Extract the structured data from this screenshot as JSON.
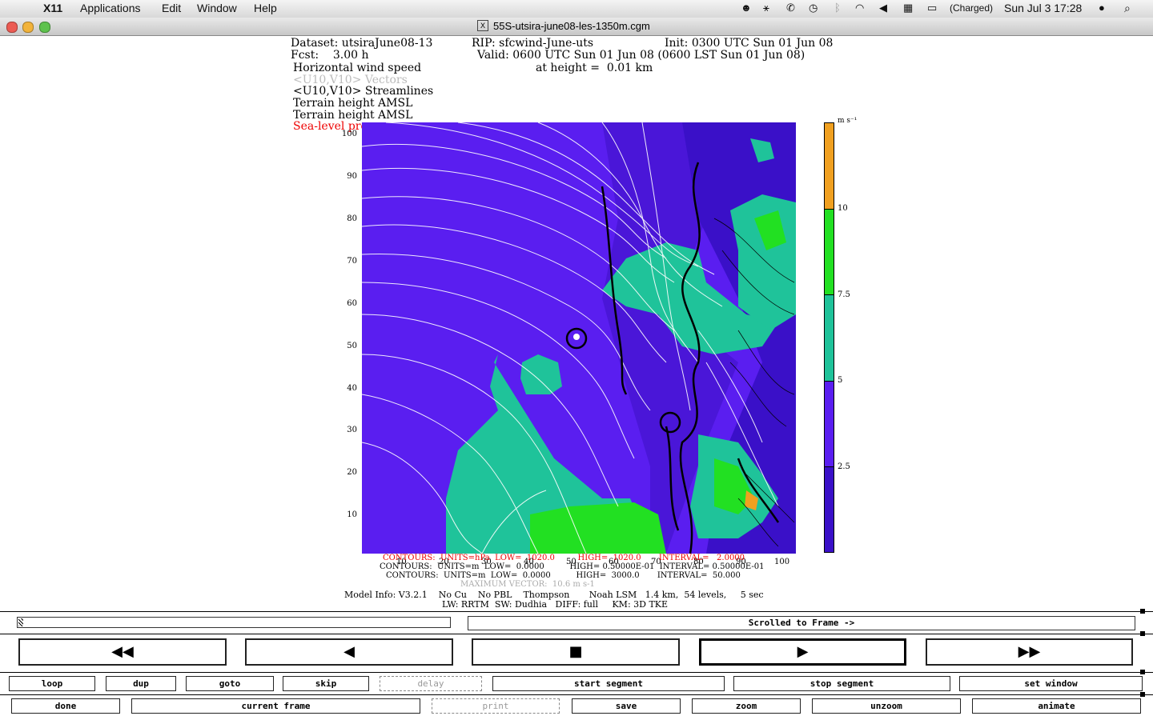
{
  "menubar": {
    "app": "X11",
    "items": [
      "Applications",
      "Edit",
      "Window",
      "Help"
    ],
    "battery": "(Charged)",
    "clock": "Sun Jul 3  17:28"
  },
  "window": {
    "title": "55S-utsira-june08-les-1350m.cgm"
  },
  "plot": {
    "line1a": "Dataset: utsiraJune08-13",
    "line1b": "RIP: sfcwind-June-uts",
    "line1c": "Init: 0300 UTC Sun 01 Jun 08",
    "line2a": "Fcst:    3.00 h",
    "line2b": "Valid: 0600 UTC Sun 01 Jun 08 (0600 LST Sun 01 Jun 08)",
    "line3a": "Horizontal wind speed",
    "line3b": "at height =  0.01 km",
    "line4": "<U10,V10> Vectors",
    "line5": "<U10,V10> Streamlines",
    "line6": "Terrain height AMSL",
    "line7": "Terrain height AMSL",
    "line8": "Sea-level pressure",
    "yticks": [
      "100",
      "90",
      "80",
      "70",
      "60",
      "50",
      "40",
      "30",
      "20",
      "10"
    ],
    "xticks": [
      "10",
      "20",
      "30",
      "40",
      "50",
      "60",
      "70",
      "80",
      "90",
      "100"
    ],
    "colorbar_unit": "m s⁻¹",
    "colorbar_ticks": [
      "10",
      "7.5",
      "5",
      "2.5"
    ],
    "colors": {
      "c1": "#3a10c8",
      "c2": "#5a1ef0",
      "c3": "#1fc39a",
      "c4": "#22e022",
      "c5": "#f0a020"
    },
    "contour1": "CONTOURS:  UNITS=hPa  LOW=  1020.0         HIGH=  1020.0       INTERVAL=   2.0000",
    "contour2": "CONTOURS:  UNITS=m  LOW=  0.0000          HIGH= 0.50000E-01  INTERVAL= 0.50000E-01",
    "contour3": "CONTOURS:  UNITS=m  LOW=  0.0000          HIGH=  3000.0       INTERVAL=  50.000",
    "maxvector": "MAXIMUM VECTOR:  10.6 m s-1",
    "model1": "Model Info: V3.2.1    No Cu    No PBL    Thompson       Noah LSM   1.4 km,  54 levels,     5 sec",
    "model2": "LW: RRTM  SW: Dudhia   DIFF: full     KM: 3D TKE"
  },
  "controls": {
    "frame_status": "Scrolled to Frame ->",
    "transport": {
      "rewind": "◀◀",
      "back": "◀",
      "stop": "■",
      "play": "▶",
      "ffwd": "▶▶"
    },
    "row1": [
      "loop",
      "dup",
      "goto",
      "skip",
      "delay",
      "start segment",
      "stop segment",
      "set window"
    ],
    "row2": [
      "done",
      "current frame",
      "print",
      "save",
      "zoom",
      "unzoom",
      "animate"
    ]
  }
}
